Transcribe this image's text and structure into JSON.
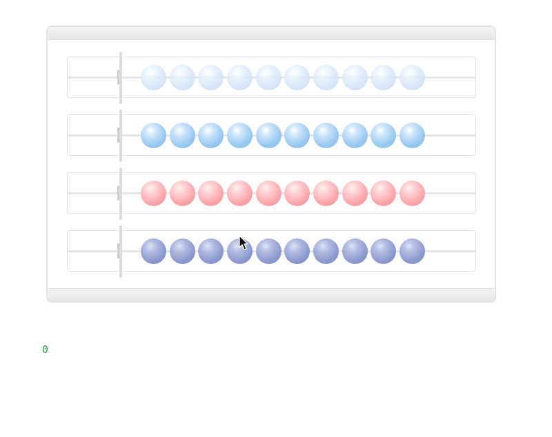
{
  "counter": {
    "value": "0"
  },
  "rows": [
    {
      "id": "row-1",
      "color": "#d4e6f8",
      "bead_count": 10
    },
    {
      "id": "row-2",
      "color": "#9ccbf1",
      "bead_count": 10
    },
    {
      "id": "row-3",
      "color": "#fba7ab",
      "bead_count": 10
    },
    {
      "id": "row-4",
      "color": "#8e9bcf",
      "bead_count": 10
    }
  ],
  "icons": {
    "cursor": "arrow-cursor-icon"
  }
}
